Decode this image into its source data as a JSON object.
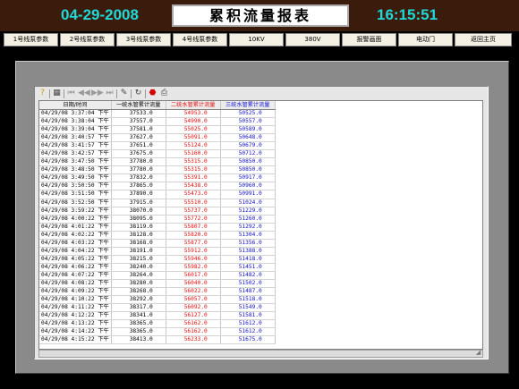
{
  "header": {
    "date": "04-29-2008",
    "title": "累积流量报表",
    "time": "16:15:51"
  },
  "nav": [
    {
      "label": "1号线泵参数"
    },
    {
      "label": "2号线泵参数"
    },
    {
      "label": "3号线泵参数"
    },
    {
      "label": "4号线泵参数"
    },
    {
      "label": "10KV"
    },
    {
      "label": "380V"
    },
    {
      "label": "报警画面"
    },
    {
      "label": "电动门"
    },
    {
      "label": "返回主页"
    }
  ],
  "toolbar": {
    "icons": [
      "help-icon",
      "table-icon",
      "first-icon",
      "prev-icon",
      "next-icon",
      "last-icon",
      "edit-icon",
      "refresh-icon",
      "stop-icon",
      "print-icon"
    ]
  },
  "table": {
    "columns": [
      "日期/时间",
      "一统水管累计流量",
      "二统水管累计流量",
      "三统水管累计流量"
    ],
    "rows": [
      [
        "04/29/08 3:37:04 下午",
        "37533.0",
        "54953.0",
        "50525.0"
      ],
      [
        "04/29/08 3:38:04 下午",
        "37557.0",
        "54990.0",
        "50557.0"
      ],
      [
        "04/29/08 3:39:04 下午",
        "37581.0",
        "55025.0",
        "50589.0"
      ],
      [
        "04/29/08 3:40:57 下午",
        "37627.0",
        "55091.0",
        "50648.0"
      ],
      [
        "04/29/08 3:41:57 下午",
        "37651.0",
        "55124.0",
        "50679.0"
      ],
      [
        "04/29/08 3:42:57 下午",
        "37675.0",
        "55160.0",
        "50712.0"
      ],
      [
        "04/29/08 3:47:50 下午",
        "37780.0",
        "55315.0",
        "50850.0"
      ],
      [
        "04/29/08 3:48:50 下午",
        "37780.0",
        "55315.0",
        "50850.0"
      ],
      [
        "04/29/08 3:49:50 下午",
        "37832.0",
        "55391.0",
        "50917.0"
      ],
      [
        "04/29/08 3:50:50 下午",
        "37865.0",
        "55438.0",
        "50960.0"
      ],
      [
        "04/29/08 3:51:50 下午",
        "37890.0",
        "55473.0",
        "50991.0"
      ],
      [
        "04/29/08 3:52:50 下午",
        "37915.0",
        "55510.0",
        "51024.0"
      ],
      [
        "04/29/08 3:59:22 下午",
        "38070.0",
        "55737.0",
        "51229.0"
      ],
      [
        "04/29/08 4:00:22 下午",
        "38095.0",
        "55772.0",
        "51260.0"
      ],
      [
        "04/29/08 4:01:22 下午",
        "38119.0",
        "55807.0",
        "51292.0"
      ],
      [
        "04/29/08 4:02:22 下午",
        "38128.0",
        "55820.0",
        "51304.0"
      ],
      [
        "04/29/08 4:03:22 下午",
        "38168.0",
        "55877.0",
        "51356.0"
      ],
      [
        "04/29/08 4:04:22 下午",
        "38191.0",
        "55912.0",
        "51388.0"
      ],
      [
        "04/29/08 4:05:22 下午",
        "38215.0",
        "55946.0",
        "51418.0"
      ],
      [
        "04/29/08 4:06:22 下午",
        "38240.0",
        "55982.0",
        "51451.0"
      ],
      [
        "04/29/08 4:07:22 下午",
        "38264.0",
        "56017.0",
        "51482.0"
      ],
      [
        "04/29/08 4:08:22 下午",
        "38280.0",
        "56040.0",
        "51502.0"
      ],
      [
        "04/29/08 4:09:22 下午",
        "38268.0",
        "56022.0",
        "51487.0"
      ],
      [
        "04/29/08 4:10:22 下午",
        "38292.0",
        "56057.0",
        "51518.0"
      ],
      [
        "04/29/08 4:11:22 下午",
        "38317.0",
        "56092.0",
        "51549.0"
      ],
      [
        "04/29/08 4:12:22 下午",
        "38341.0",
        "56127.0",
        "51581.0"
      ],
      [
        "04/29/08 4:13:22 下午",
        "38365.0",
        "56162.0",
        "51612.0"
      ],
      [
        "04/29/08 4:14:22 下午",
        "38365.0",
        "56162.0",
        "51612.0"
      ],
      [
        "04/29/08 4:15:22 下午",
        "38413.0",
        "56233.0",
        "51675.0"
      ]
    ]
  },
  "colors": {
    "header_bg": "#3b1c0c",
    "time_cyan": "#1fd8d8",
    "col2": "#e01010",
    "col3": "#1010d0"
  }
}
